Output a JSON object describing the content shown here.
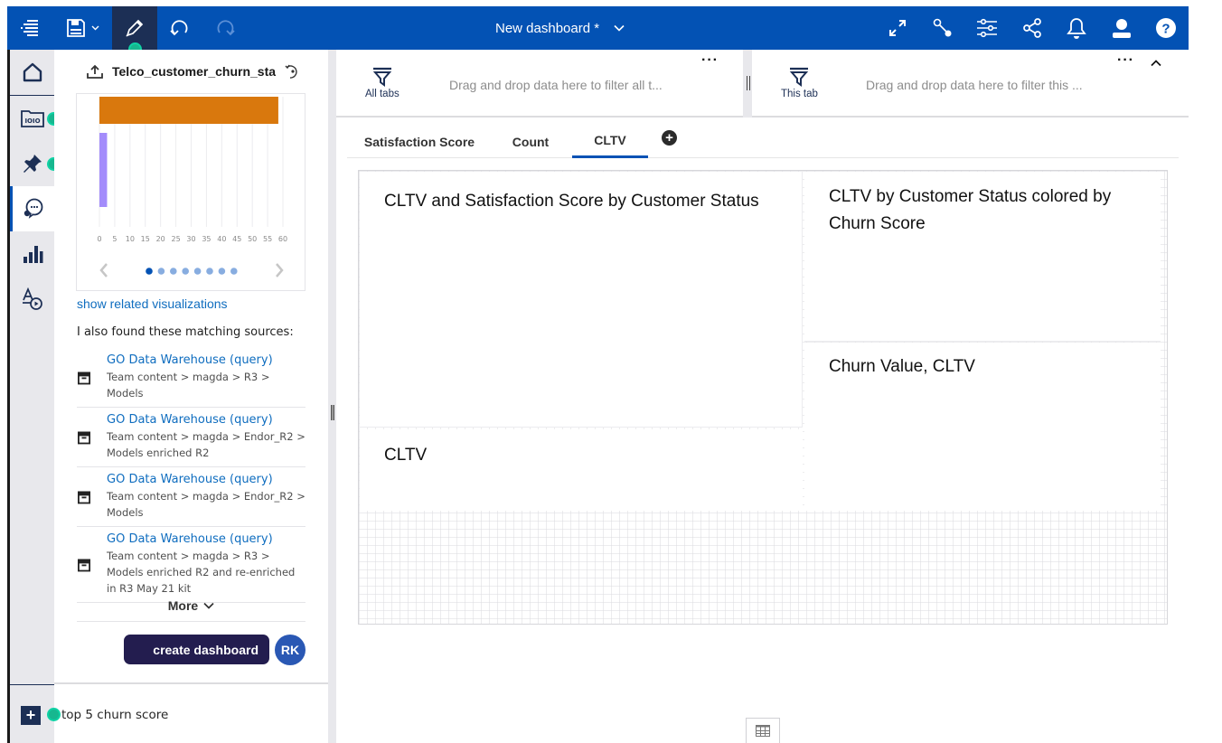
{
  "topbar": {
    "title": "New dashboard *",
    "left_icons": [
      "menu-icon",
      "save-icon",
      "edit-pencil-icon",
      "undo-icon",
      "redo-icon"
    ],
    "right_icons": [
      "expand-icon",
      "relationship-icon",
      "properties-sliders-icon",
      "share-icon",
      "notification-bell-icon",
      "user-profile-icon",
      "help-icon"
    ]
  },
  "rail": {
    "items": [
      "home-icon",
      "data-sources-icon",
      "pin-icon",
      "assistant-chat-icon",
      "visualizations-icon",
      "text-media-icon"
    ],
    "active": "assistant-chat-icon"
  },
  "assistant": {
    "source_title": "Telco_customer_churn_sta",
    "chart": {
      "x_ticks": [
        "0",
        "5",
        "10",
        "15",
        "20",
        "25",
        "30",
        "35",
        "40",
        "45",
        "50",
        "55",
        "60"
      ],
      "pager_count": 8,
      "pager_active": 0
    },
    "related_link": "show related visualizations",
    "sources_heading": "I also found these matching sources:",
    "sources": [
      {
        "name": "GO Data Warehouse (query)",
        "path": "Team content > magda > R3 > Models"
      },
      {
        "name": "GO Data Warehouse (query)",
        "path": "Team content > magda > Endor_R2 > Models enriched R2"
      },
      {
        "name": "GO Data Warehouse (query)",
        "path": "Team content > magda > Endor_R2 > Models"
      },
      {
        "name": "GO Data Warehouse (query)",
        "path": "Team content > magda > R3 > Models enriched R2 and re-enriched in R3 May 21 kit"
      }
    ],
    "more_label": "More",
    "create_label": "create dashboard",
    "avatar_initials": "RK",
    "input_value": "top 5 churn score"
  },
  "filters": {
    "all_tabs_label": "All tabs",
    "all_tabs_hint": "Drag and drop data here to filter all t...",
    "this_tab_label": "This tab",
    "this_tab_hint": "Drag and drop data here to filter this ..."
  },
  "tabs": [
    {
      "label": "Satisfaction Score",
      "active": false
    },
    {
      "label": "Count",
      "active": false
    },
    {
      "label": "CLTV",
      "active": true
    }
  ],
  "widgets": [
    {
      "title": "CLTV and Satisfaction Score by Customer Status"
    },
    {
      "title": "CLTV by Customer Status colored by Churn Score"
    },
    {
      "title": "Churn Value, CLTV"
    },
    {
      "title": "CLTV"
    }
  ],
  "chart_data": {
    "type": "bar",
    "orientation": "horizontal",
    "title": "",
    "categories": [
      "",
      ""
    ],
    "values": [
      58.5,
      2.5
    ],
    "colors": [
      "#d9780d",
      "#a38cfb"
    ],
    "xlabel": "",
    "ylabel": "",
    "xlim": [
      0,
      60
    ],
    "x_ticks": [
      0,
      5,
      10,
      15,
      20,
      25,
      30,
      35,
      40,
      45,
      50,
      55,
      60
    ],
    "grid": true
  }
}
